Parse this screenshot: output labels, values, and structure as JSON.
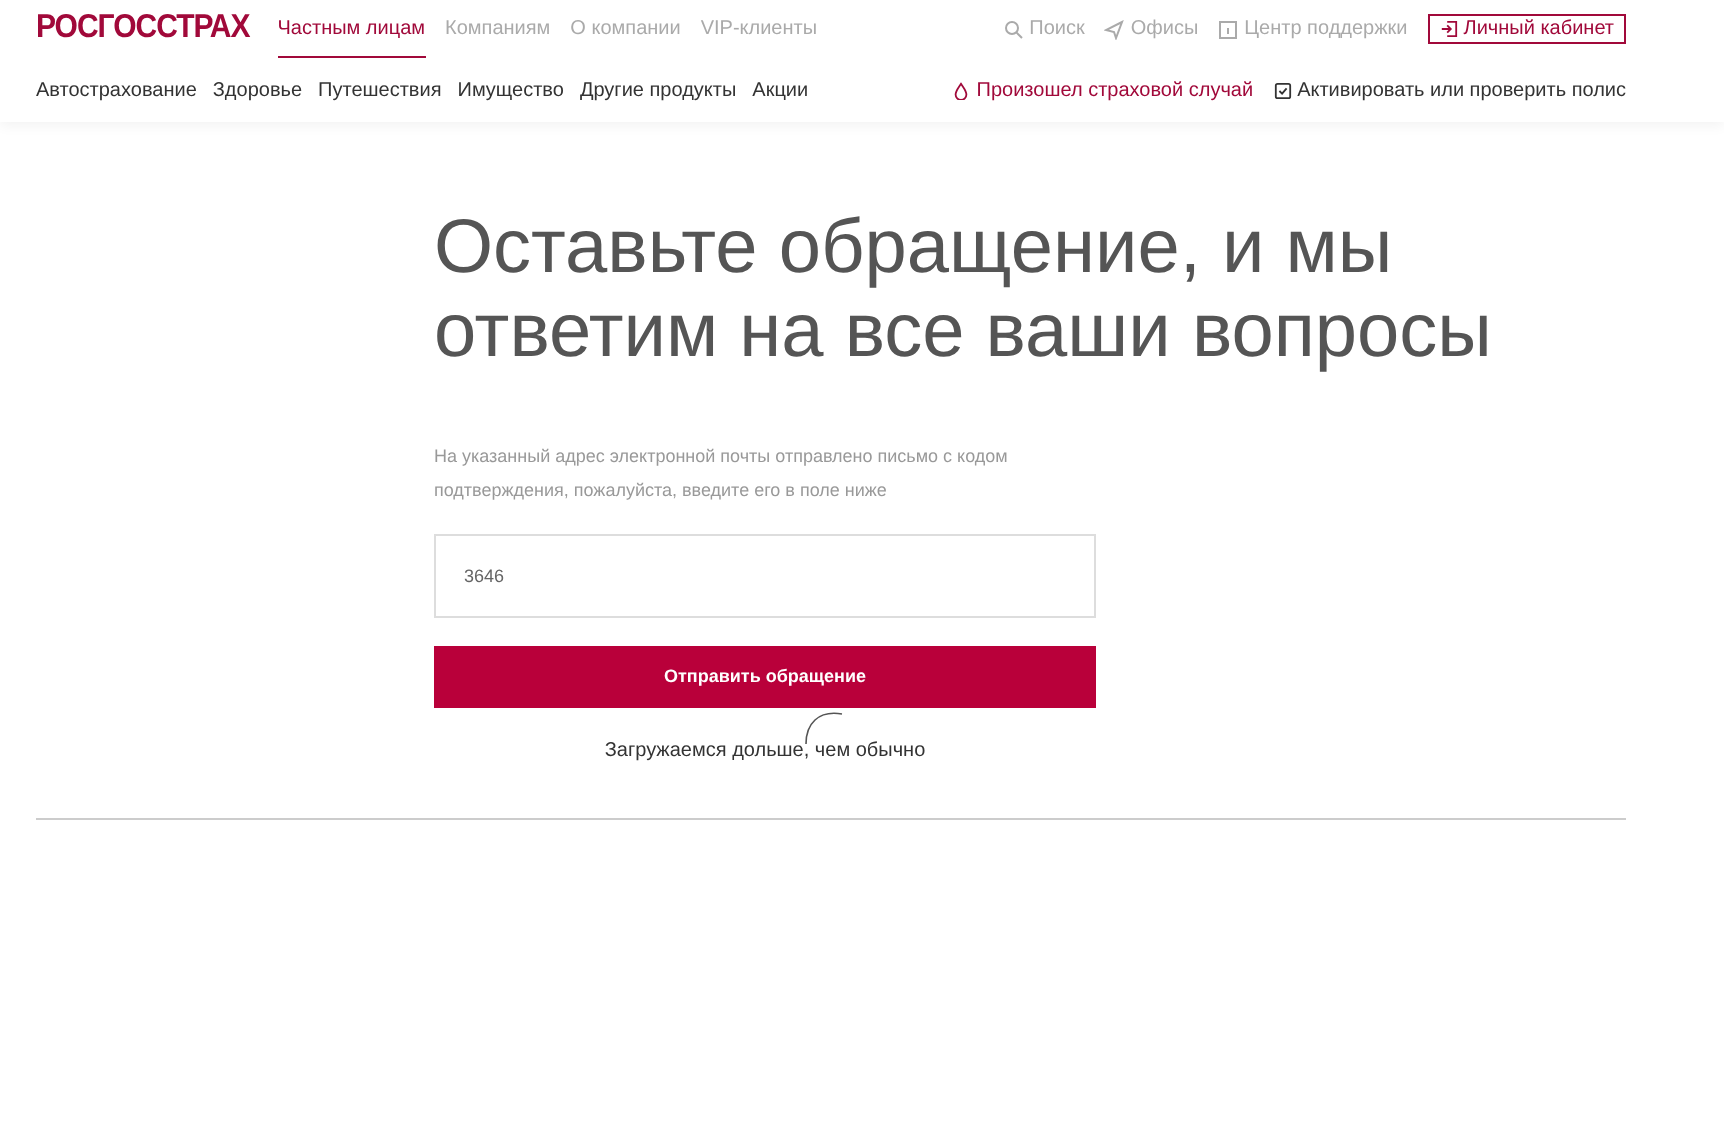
{
  "header": {
    "logo": "РОСГОССТРАХ",
    "tabs": [
      {
        "label": "Частным лицам",
        "selected": true
      },
      {
        "label": "Компаниям",
        "selected": false
      },
      {
        "label": "О компании",
        "selected": false
      },
      {
        "label": "VIP-клиенты",
        "selected": false
      }
    ],
    "utility_links": [
      {
        "label": "Поиск",
        "kind": "search"
      },
      {
        "label": "Офисы",
        "kind": "offices"
      },
      {
        "label": "Центр поддержки",
        "kind": "support"
      }
    ],
    "account_button": "Личный кабинет",
    "categories": [
      "Автострахование",
      "Здоровье",
      "Путешествия",
      "Имущество",
      "Другие продукты",
      "Акции"
    ],
    "claim_link": "Произошел страховой случай",
    "policy_link": "Активировать или проверить полис"
  },
  "form": {
    "title": "Оставьте обращение, и мы ответим на все ваши вопросы",
    "note": "На указанный адрес электронной почты отправлено письмо с кодом подтверждения, пожалуйста, введите его в поле ниже",
    "code_value": "3646",
    "submit": "Отправить обращение",
    "loading_text": "Загружаемся дольше, чем обычно"
  }
}
